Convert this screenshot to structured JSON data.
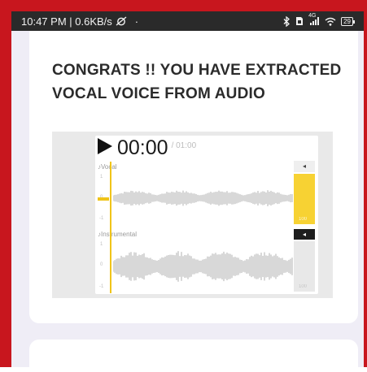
{
  "status_bar": {
    "left_text": "10:47 PM | 0.6KB/s",
    "dot": "·",
    "network_label": "4G",
    "battery_level": "29",
    "icons": [
      "alarm-off-icon",
      "bluetooth-icon",
      "sim-icon",
      "signal-icon",
      "wifi-icon",
      "battery-icon"
    ]
  },
  "card": {
    "headline": "CONGRATS !! YOU HAVE EXTRACTED VOCAL VOICE FROM AUDIO"
  },
  "preview": {
    "current_time": "00:00",
    "total_time": "/ 01:00",
    "tracks": [
      {
        "label": "Vocal",
        "mute_icon": "speaker-icon",
        "volume_label": "100",
        "accent": "#f7d233",
        "scale_top": "1",
        "scale_mid": "0",
        "scale_bot": "-1"
      },
      {
        "label": "Instrumental",
        "mute_icon": "speaker-icon",
        "volume_label": "100",
        "accent": "#1e1e1e",
        "scale_top": "1",
        "scale_mid": "0",
        "scale_bot": "-1"
      }
    ]
  },
  "colors": {
    "frame": "#c8161e",
    "status_bar": "#2a2a2a",
    "app_bg": "#efedf6",
    "accent": "#f7d233"
  }
}
